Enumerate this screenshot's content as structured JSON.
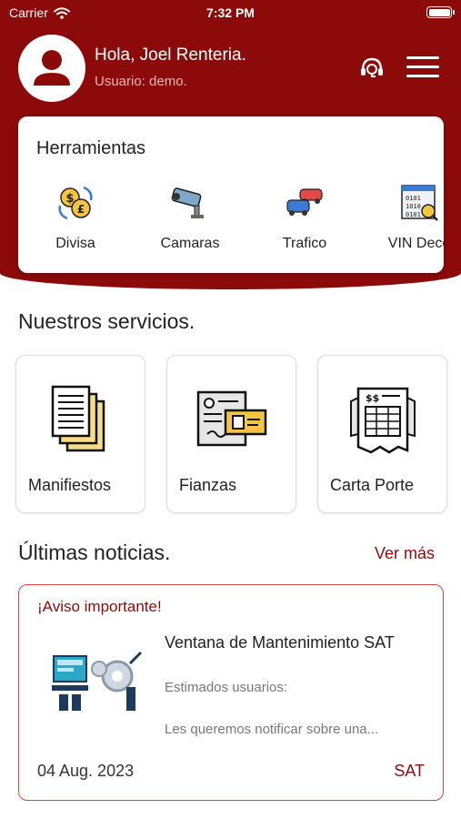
{
  "status_bar": {
    "carrier": "Carrier",
    "time": "7:32 PM"
  },
  "header": {
    "greeting": "Hola, Joel Renteria.",
    "username": "Usuario: demo.",
    "avatar_icon": "person-icon",
    "support_icon": "support-icon",
    "menu_icon": "hamburger-menu-icon"
  },
  "tools": {
    "title": "Herramientas",
    "items": [
      {
        "label": "Divisa",
        "icon": "currency-exchange-icon"
      },
      {
        "label": "Camaras",
        "icon": "security-camera-icon"
      },
      {
        "label": "Trafico",
        "icon": "traffic-cars-icon"
      },
      {
        "label": "VIN Deco",
        "icon": "vin-decoder-icon"
      }
    ]
  },
  "services": {
    "title": "Nuestros servicios.",
    "items": [
      {
        "label": "Manifiestos",
        "icon": "documents-icon"
      },
      {
        "label": "Fianzas",
        "icon": "bond-certificate-icon"
      },
      {
        "label": "Carta Porte",
        "icon": "invoice-icon"
      }
    ]
  },
  "news": {
    "title": "Últimas noticias.",
    "see_more": "Ver más",
    "item": {
      "tag": "¡Aviso importante!",
      "headline": "Ventana de Mantenimiento SAT",
      "body_line1": "Estimados usuarios:",
      "body_line2": "Les queremos notificar sobre una...",
      "date": "04 Aug. 2023",
      "source": "SAT"
    }
  },
  "colors": {
    "brand": "#8c0a0a",
    "news_border": "#d64545",
    "background": "#ffffff"
  }
}
